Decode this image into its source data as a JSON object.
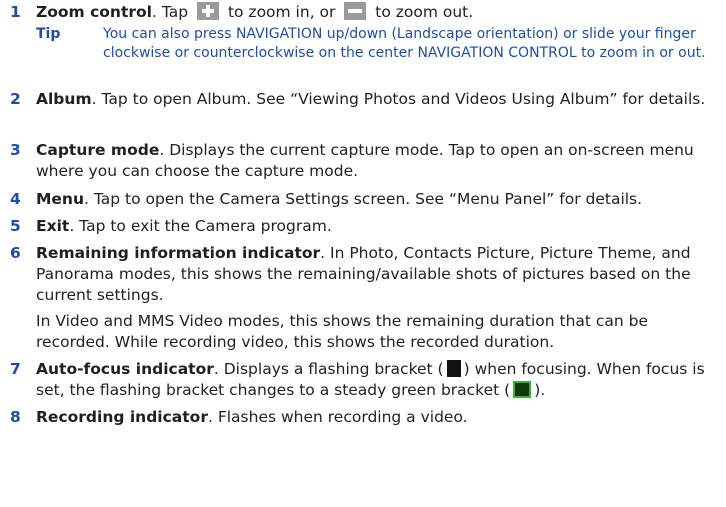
{
  "items": [
    {
      "num": "1",
      "term": "Zoom control",
      "text_a": ". Tap ",
      "text_b": " to zoom in, or ",
      "text_c": " to zoom out."
    },
    {
      "tip_label": "Tip",
      "tip_text": "You can also press NAVIGATION up/down (Landscape orientation) or slide your finger clockwise or counterclockwise on the center NAVIGATION CONTROL to zoom in or out."
    },
    {
      "num": "2",
      "term": "Album",
      "text": ". Tap to open Album. See “Viewing Photos and Videos Using Album” for details."
    },
    {
      "num": "3",
      "term": "Capture mode",
      "text": ". Displays the current capture mode. Tap to open an on-screen menu where you can choose the capture mode."
    },
    {
      "num": "4",
      "term": "Menu",
      "text": ". Tap to open the Camera Settings screen. See “Menu Panel” for details."
    },
    {
      "num": "5",
      "term": "Exit",
      "text": ". Tap to exit the Camera program."
    },
    {
      "num": "6",
      "term": "Remaining information indicator",
      "text": ". In Photo, Contacts Picture, Picture Theme, and Panorama modes, this shows the remaining/available shots of pictures based on the current settings.",
      "text2": "In Video and MMS Video modes, this shows the remaining duration that can be recorded. While recording video, this shows the recorded duration."
    },
    {
      "num": "7",
      "term": "Auto-focus indicator",
      "text_a": ". Displays a flashing bracket (",
      "text_b": ") when focusing. When focus is set, the flashing bracket changes to a steady green bracket (",
      "text_c": ")."
    },
    {
      "num": "8",
      "term": "Recording indicator",
      "text": ". Flashes when recording a video."
    }
  ],
  "icons": {
    "zoom_in": "plus-icon",
    "zoom_out": "minus-icon",
    "flashing_bracket": "focus-bracket-icon",
    "green_bracket": "green-bracket-icon"
  },
  "colors": {
    "accent": "#1f4e9c",
    "text": "#231f20"
  }
}
